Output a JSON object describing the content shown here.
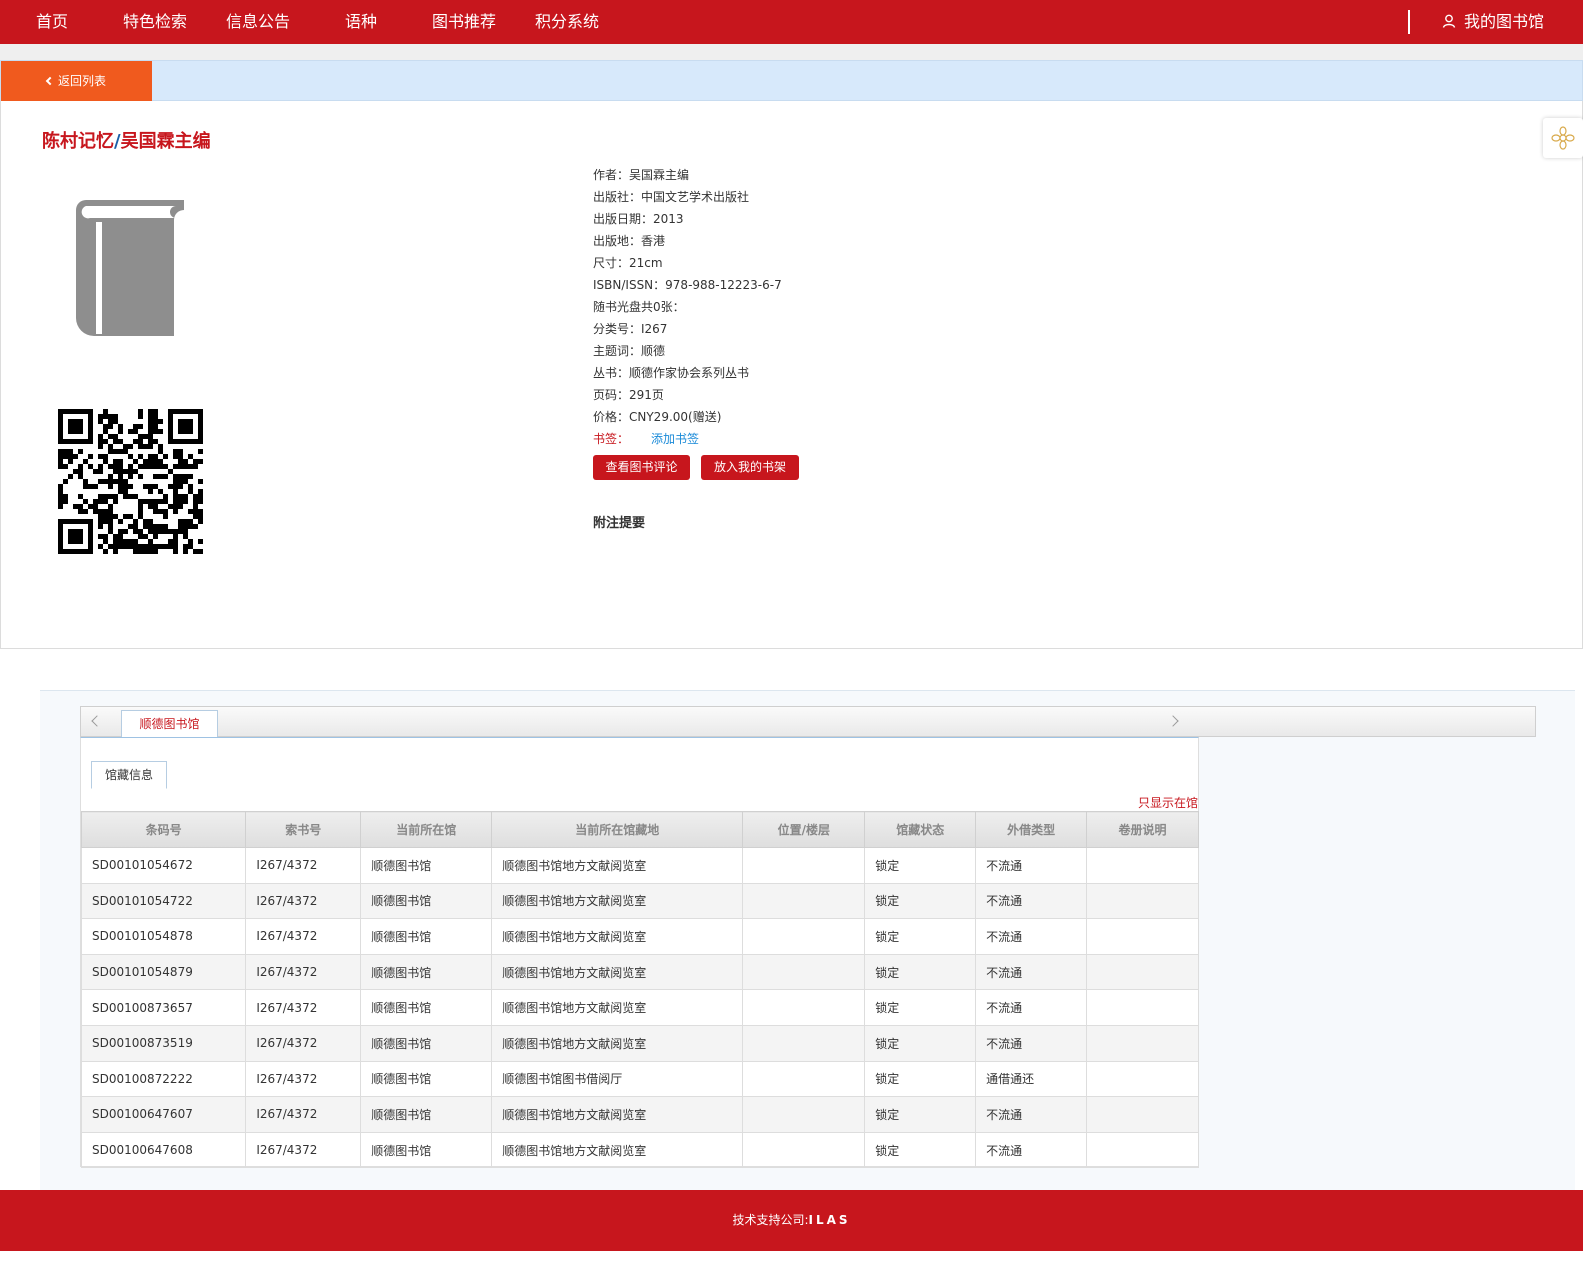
{
  "nav": {
    "items": [
      "首页",
      "特色检索",
      "信息公告",
      "语种",
      "图书推荐",
      "积分系统"
    ],
    "my_library": "我的图书馆"
  },
  "back_label": "返回列表",
  "book": {
    "title": "陈村记忆",
    "separator": "/",
    "responsibility": "吴国霖主编"
  },
  "meta": [
    "作者：吴国霖主编",
    "出版社：中国文艺学术出版社",
    "出版日期：2013",
    "出版地：香港",
    "尺寸：21cm",
    "ISBN/ISSN：978-988-12223-6-7",
    "随书光盘共0张：",
    "分类号：I267",
    "主题词：顺德",
    "丛书：顺德作家协会系列丛书",
    "页码：291页",
    "价格：CNY29.00(赠送)"
  ],
  "bookmark": {
    "label": "书签：",
    "link": "添加书签"
  },
  "buttons": {
    "view_reviews": "查看图书评论",
    "add_shelf": "放入我的书架"
  },
  "notes_title": "附注提要",
  "holdings": {
    "library_tab": "顺德图书馆",
    "sub_tab": "馆藏信息",
    "show_in_library": "只显示在馆",
    "columns": [
      "条码号",
      "索书号",
      "当前所在馆",
      "当前所在馆藏地",
      "位置/楼层",
      "馆藏状态",
      "外借类型",
      "卷册说明"
    ],
    "rows": [
      [
        "SD00101054672",
        "I267/4372",
        "顺德图书馆",
        "顺德图书馆地方文献阅览室",
        "",
        "锁定",
        "不流通",
        ""
      ],
      [
        "SD00101054722",
        "I267/4372",
        "顺德图书馆",
        "顺德图书馆地方文献阅览室",
        "",
        "锁定",
        "不流通",
        ""
      ],
      [
        "SD00101054878",
        "I267/4372",
        "顺德图书馆",
        "顺德图书馆地方文献阅览室",
        "",
        "锁定",
        "不流通",
        ""
      ],
      [
        "SD00101054879",
        "I267/4372",
        "顺德图书馆",
        "顺德图书馆地方文献阅览室",
        "",
        "锁定",
        "不流通",
        ""
      ],
      [
        "SD00100873657",
        "I267/4372",
        "顺德图书馆",
        "顺德图书馆地方文献阅览室",
        "",
        "锁定",
        "不流通",
        ""
      ],
      [
        "SD00100873519",
        "I267/4372",
        "顺德图书馆",
        "顺德图书馆地方文献阅览室",
        "",
        "锁定",
        "不流通",
        ""
      ],
      [
        "SD00100872222",
        "I267/4372",
        "顺德图书馆",
        "顺德图书馆图书借阅厅",
        "",
        "锁定",
        "通借通还",
        ""
      ],
      [
        "SD00100647607",
        "I267/4372",
        "顺德图书馆",
        "顺德图书馆地方文献阅览室",
        "",
        "锁定",
        "不流通",
        ""
      ],
      [
        "SD00100647608",
        "I267/4372",
        "顺德图书馆",
        "顺德图书馆地方文献阅览室",
        "",
        "锁定",
        "不流通",
        ""
      ]
    ]
  },
  "footer": {
    "label": "技术支持公司:",
    "brand": "ILAS"
  },
  "colors": {
    "brand_red": "#c7161d",
    "back_orange": "#f05a1e",
    "link_blue": "#1a8ad8"
  }
}
